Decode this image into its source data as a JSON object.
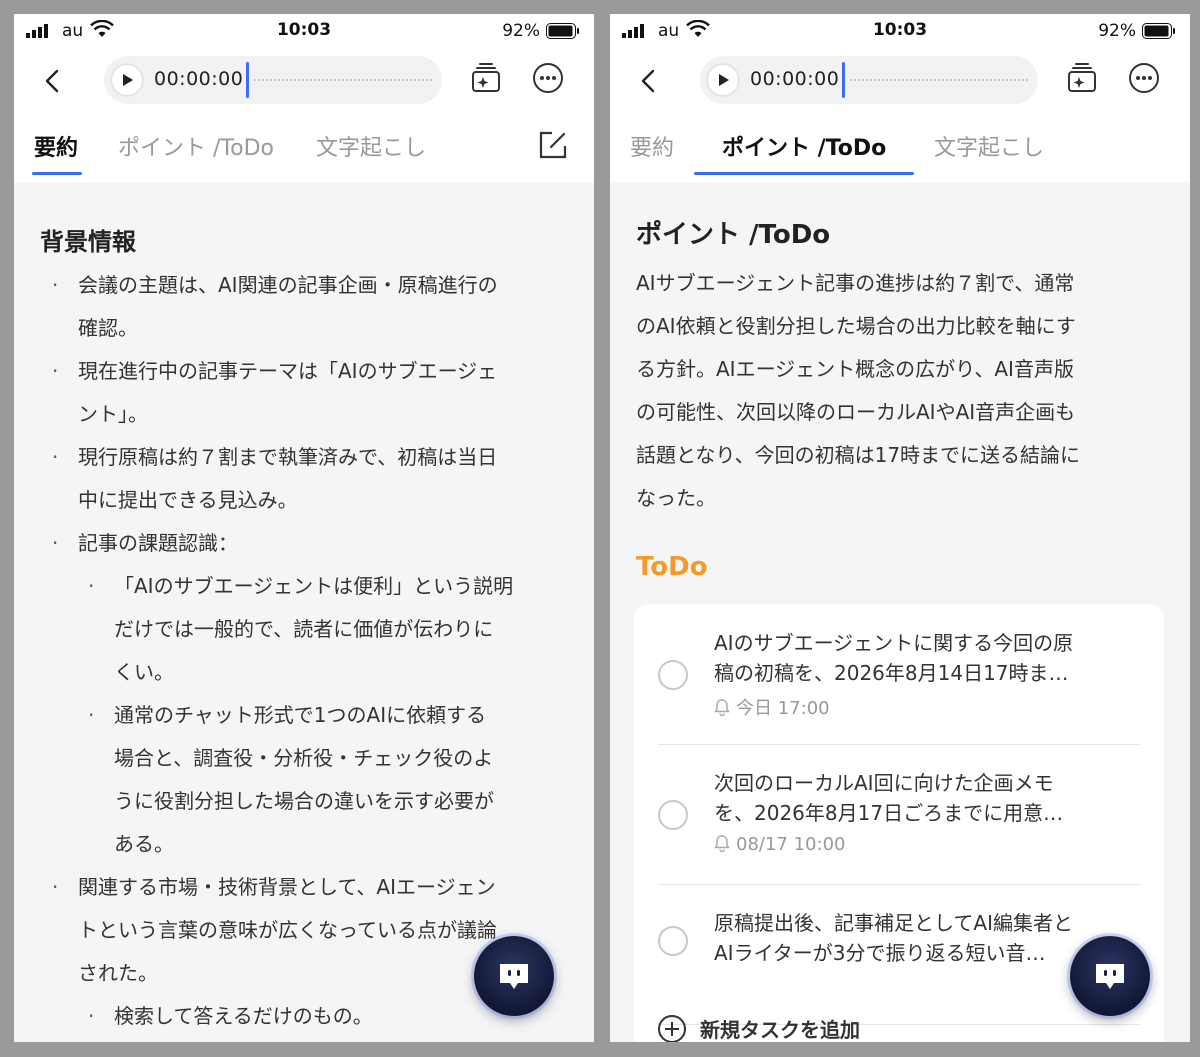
{
  "status_bar": {
    "carrier": "au",
    "time": "10:03",
    "battery": "92%"
  },
  "player": {
    "time": "00:00:00"
  },
  "tabs": [
    {
      "label": "要約"
    },
    {
      "label": "ポイント /ToDo"
    },
    {
      "label": "文字起こし"
    }
  ],
  "left_screen": {
    "active_tab": "要約",
    "heading": "背景情報",
    "bullets": [
      {
        "level": 1,
        "lines": [
          "会議の主題は、AI関連の記事企画・原稿進行の",
          "確認。"
        ]
      },
      {
        "level": 1,
        "lines": [
          "現在進行中の記事テーマは「AIのサブエージェ",
          "ント」。"
        ]
      },
      {
        "level": 1,
        "lines": [
          "現行原稿は約７割まで執筆済みで、初稿は当日",
          "中に提出できる見込み。"
        ]
      },
      {
        "level": 1,
        "lines": [
          "記事の課題認識："
        ]
      },
      {
        "level": 2,
        "lines": [
          "「AIのサブエージェントは便利」という説明",
          "だけでは一般的で、読者に価値が伝わりに",
          "くい。"
        ]
      },
      {
        "level": 2,
        "lines": [
          "通常のチャット形式で1つのAIに依頼する",
          "場合と、調査役・分析役・チェック役のよ",
          "うに役割分担した場合の違いを示す必要が",
          "ある。"
        ]
      },
      {
        "level": 1,
        "lines": [
          "関連する市場・技術背景として、AIエージェン",
          "トという言葉の意味が広くなっている点が議論",
          "された。"
        ]
      },
      {
        "level": 2,
        "lines": [
          "検索して答えるだけのもの。"
        ]
      }
    ]
  },
  "right_screen": {
    "active_tab": "ポイント /ToDo",
    "points_title": "ポイント /ToDo",
    "points_lines": [
      "AIサブエージェント記事の進捗は約７割で、通常",
      "のAI依頼と役割分担した場合の出力比較を軸にす",
      "る方針。AIエージェント概念の広がり、AI音声版",
      "の可能性、次回以降のローカルAIやAI音声企画も",
      "話題となり、今回の初稿は17時までに送る結論に",
      "なった。"
    ],
    "todo_heading": "ToDo",
    "todos": [
      {
        "lines": [
          "AIのサブエージェントに関する今回の原",
          "稿の初稿を、2026年8月14日17時ま…"
        ],
        "reminder": "今日 17:00"
      },
      {
        "lines": [
          "次回のローカルAI回に向けた企画メモ",
          "を、2026年8月17日ごろまでに用意…"
        ],
        "reminder": "08/17 10:00"
      },
      {
        "lines": [
          "原稿提出後、記事補足としてAI編集者と",
          "AIライターが3分で振り返る短い音…"
        ],
        "reminder": ""
      }
    ],
    "add_task_label": "新規タスクを追加"
  },
  "colors": {
    "accent": "#3b6ef5",
    "todo_heading": "#f39a2b",
    "chat_fab": "#1a2147"
  },
  "icons": {
    "back": "chevron-left-icon",
    "play": "play-icon",
    "ai_magic": "ai-magic-icon",
    "more": "more-horizontal-icon",
    "edit": "edit-icon",
    "bell": "bell-icon",
    "chat": "chat-bot-icon"
  }
}
